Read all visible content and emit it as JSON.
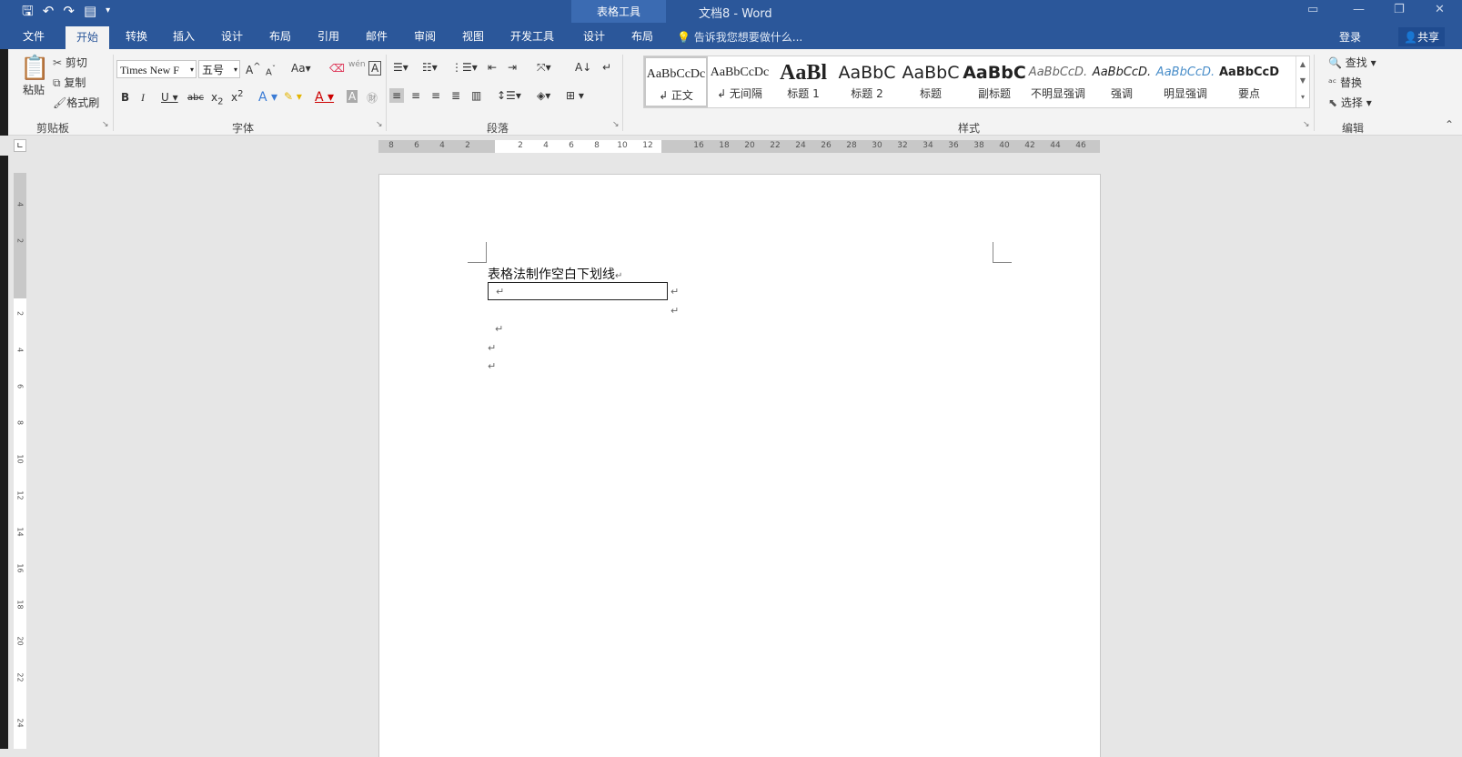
{
  "titlebar": {
    "context_tools": "表格工具",
    "document_title": "文档8 - Word"
  },
  "tabs": [
    {
      "label": "文件"
    },
    {
      "label": "开始"
    },
    {
      "label": "转换"
    },
    {
      "label": "插入"
    },
    {
      "label": "设计"
    },
    {
      "label": "布局"
    },
    {
      "label": "引用"
    },
    {
      "label": "邮件"
    },
    {
      "label": "审阅"
    },
    {
      "label": "视图"
    },
    {
      "label": "开发工具"
    },
    {
      "label": "设计"
    },
    {
      "label": "布局"
    }
  ],
  "tell_me": "告诉我您想要做什么...",
  "account": {
    "login": "登录",
    "share": "共享"
  },
  "clipboard": {
    "paste": "粘贴",
    "cut": "剪切",
    "copy": "复制",
    "format_painter": "格式刷",
    "group": "剪贴板"
  },
  "font": {
    "name": "Times New F",
    "size": "五号",
    "group": "字体",
    "case": "Aa"
  },
  "paragraph": {
    "group": "段落"
  },
  "styles": {
    "group": "样式",
    "items": [
      {
        "preview": "AaBbCcDc",
        "name": "↲ 正文"
      },
      {
        "preview": "AaBbCcDc",
        "name": "↲ 无间隔"
      },
      {
        "preview": "AaBl",
        "name": "标题 1"
      },
      {
        "preview": "AaBbC",
        "name": "标题 2"
      },
      {
        "preview": "AaBbC",
        "name": "标题"
      },
      {
        "preview": "AaBbC",
        "name": "副标题"
      },
      {
        "preview": "AaBbCcD.",
        "name": "不明显强调"
      },
      {
        "preview": "AaBbCcD.",
        "name": "强调"
      },
      {
        "preview": "AaBbCcD.",
        "name": "明显强调"
      },
      {
        "preview": "AaBbCcD",
        "name": "要点"
      }
    ]
  },
  "editing": {
    "find": "查找",
    "replace": "替换",
    "select": "选择",
    "group": "编辑"
  },
  "ruler": {
    "h_left": [
      "8",
      "6",
      "4",
      "2"
    ],
    "h_right": [
      "2",
      "4",
      "6",
      "8",
      "10",
      "12"
    ],
    "h_far": [
      "16",
      "18",
      "20",
      "22",
      "24",
      "26",
      "28",
      "30",
      "32",
      "34",
      "36",
      "38",
      "40",
      "42",
      "44",
      "46"
    ],
    "v": [
      "4",
      "2",
      "2",
      "4",
      "6",
      "8",
      "10",
      "12",
      "14",
      "16",
      "18",
      "20",
      "22",
      "24"
    ]
  },
  "document": {
    "line1": "表格法制作空白下划线",
    "para_mark": "↵"
  }
}
